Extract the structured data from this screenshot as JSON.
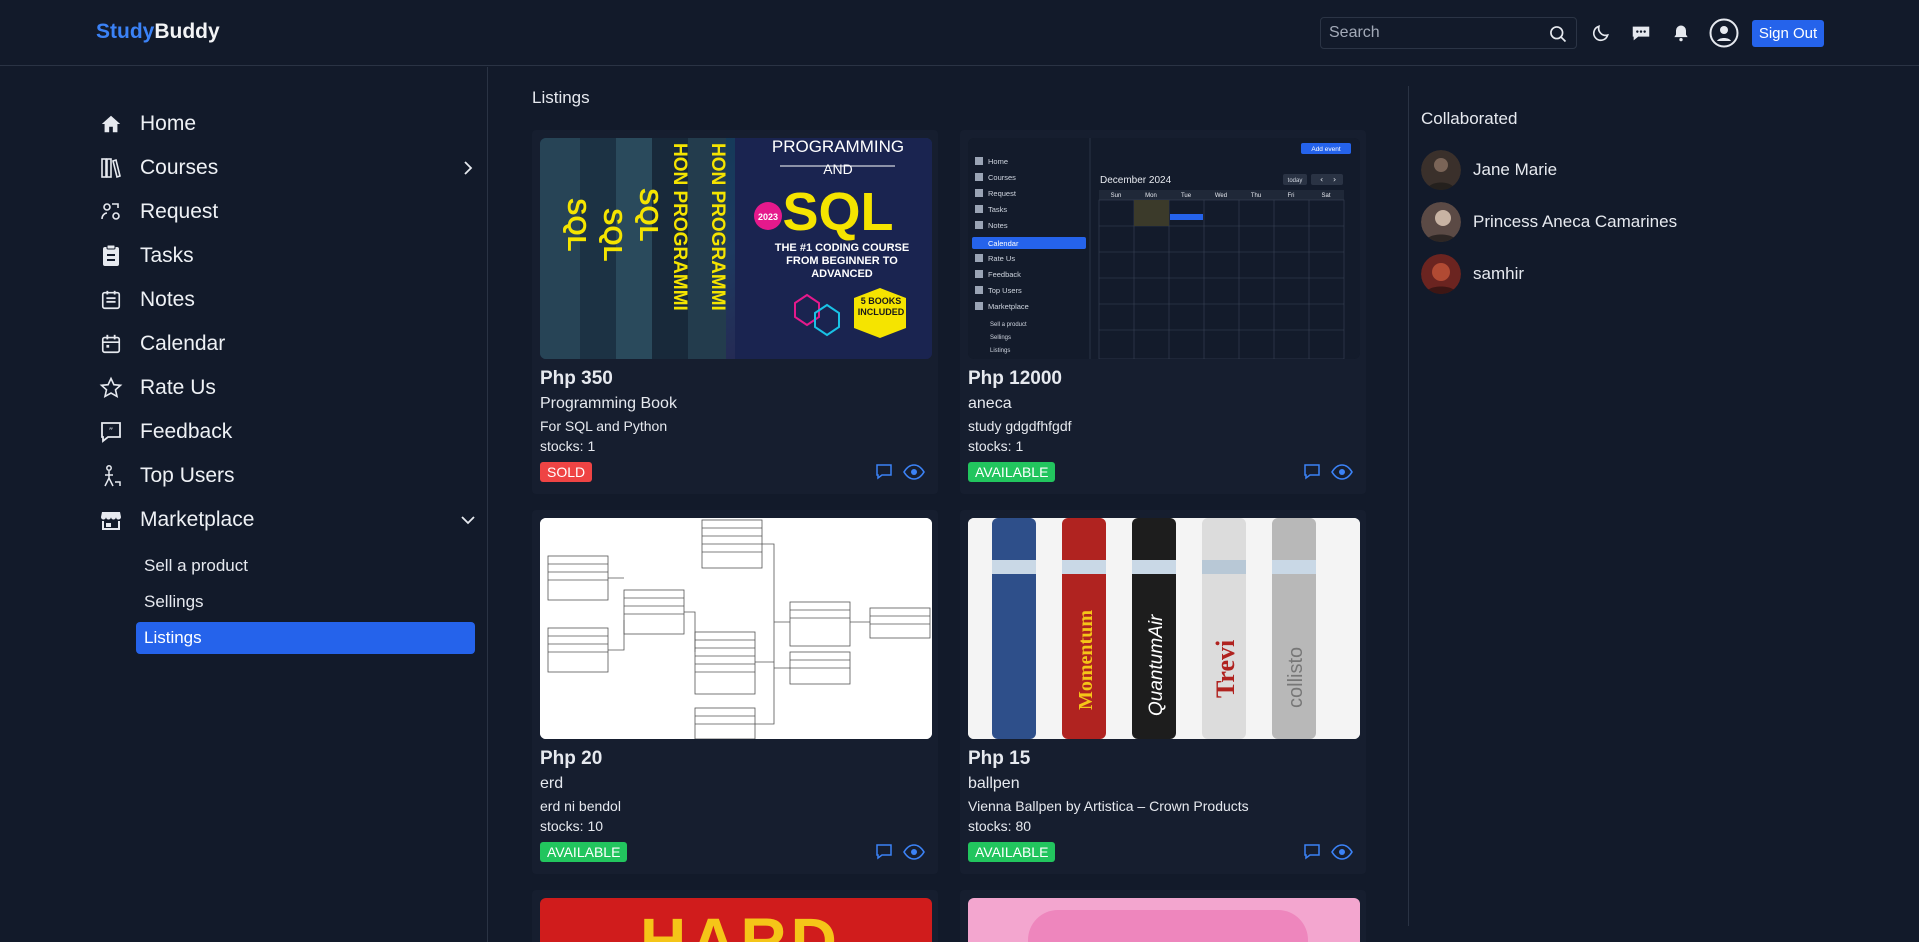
{
  "brand": {
    "part1": "Study",
    "part2": "Buddy",
    "accent": "#3b82f6"
  },
  "topbar": {
    "search_placeholder": "Search",
    "icons": [
      "search-icon",
      "moon-icon",
      "chat-icon",
      "bell-icon",
      "user-icon"
    ],
    "signout_label": "Sign Out"
  },
  "sidebar": {
    "items": [
      {
        "label": "Home",
        "icon": "home-icon"
      },
      {
        "label": "Courses",
        "icon": "courses-icon"
      },
      {
        "label": "Request",
        "icon": "request-icon"
      },
      {
        "label": "Tasks",
        "icon": "tasks-icon"
      },
      {
        "label": "Notes",
        "icon": "notes-icon"
      },
      {
        "label": "Calendar",
        "icon": "calendar-icon"
      },
      {
        "label": "Rate Us",
        "icon": "star-icon"
      },
      {
        "label": "Feedback",
        "icon": "feedback-icon"
      },
      {
        "label": "Top Users",
        "icon": "top-users-icon"
      },
      {
        "label": "Marketplace",
        "icon": "store-icon"
      }
    ],
    "sub_items": [
      {
        "label": "Sell a product",
        "active": false
      },
      {
        "label": "Sellings",
        "active": false
      },
      {
        "label": "Listings",
        "active": true
      }
    ]
  },
  "main": {
    "title": "Listings",
    "cards": [
      {
        "price": "Php 350",
        "name": "Programming Book",
        "desc": "For SQL and Python",
        "stock": "stocks: 1",
        "status": "SOLD",
        "status_color": "#ef4444"
      },
      {
        "price": "Php 12000",
        "name": "aneca",
        "desc": "study gdgdfhfgdf",
        "stock": "stocks: 1",
        "status": "AVAILABLE",
        "status_color": "#22c55e"
      },
      {
        "price": "Php 20",
        "name": "erd",
        "desc": "erd ni bendol",
        "stock": "stocks: 10",
        "status": "AVAILABLE",
        "status_color": "#22c55e"
      },
      {
        "price": "Php 15",
        "name": "ballpen",
        "desc": "Vienna Ballpen by Artistica – Crown Products",
        "stock": "stocks: 80",
        "status": "AVAILABLE",
        "status_color": "#22c55e"
      }
    ],
    "book_cover": {
      "spine": [
        "SQL",
        "SQL",
        "SQL"
      ],
      "spine2": [
        "HON PROGRAMMI",
        "HON PROGRAMMI"
      ],
      "title1": "PROGRAMMING",
      "title2": "AND",
      "title3": "SQL",
      "year": "2023",
      "tagline": "THE #1 CODING COURSE FROM BEGINNER TO ADVANCED",
      "books": "5 BOOKS INCLUDED"
    },
    "calendar_shot": {
      "month": "December 2024",
      "add_event": "Add event",
      "today": "today",
      "days": [
        "Sun",
        "Mon",
        "Tue",
        "Wed",
        "Thu",
        "Fri",
        "Sat"
      ],
      "menu": [
        "Home",
        "Courses",
        "Request",
        "Tasks",
        "Notes",
        "Calendar",
        "Rate Us",
        "Feedback",
        "Top Users",
        "Marketplace",
        "Sell a product",
        "Sellings",
        "Listings"
      ]
    },
    "pens": [
      "Momentum",
      "QuantumAir",
      "Trevi",
      "collisto"
    ],
    "partial_card_text": "HARD"
  },
  "collaborated": {
    "title": "Collaborated",
    "users": [
      {
        "name": "Jane Marie"
      },
      {
        "name": "Princess Aneca Camarines"
      },
      {
        "name": "samhir"
      }
    ]
  }
}
